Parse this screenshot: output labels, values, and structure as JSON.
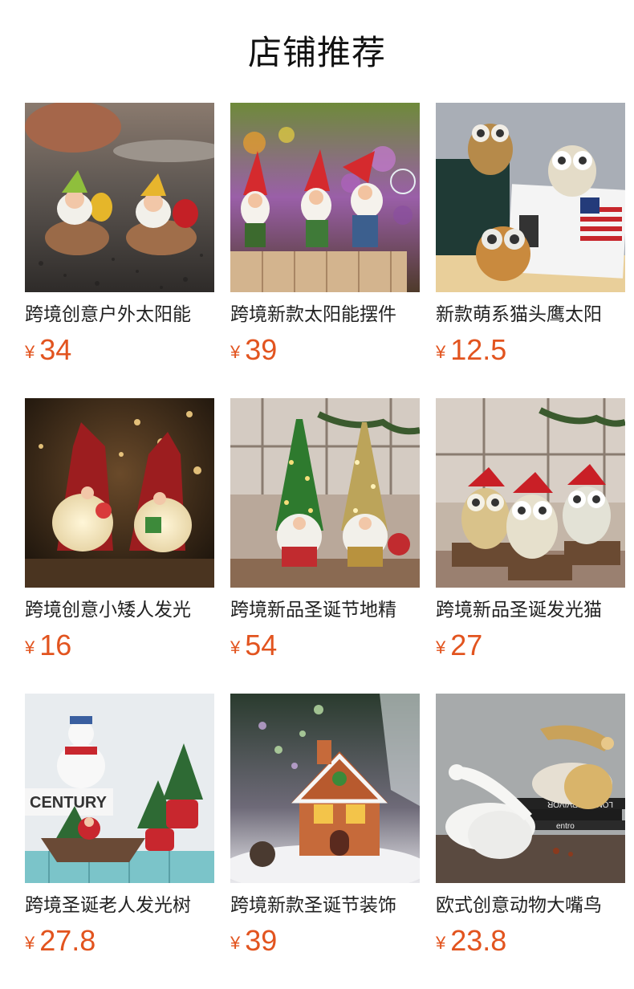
{
  "header": {
    "title": "店铺推荐"
  },
  "currency_symbol": "¥",
  "colors": {
    "price": "#e2541f",
    "text": "#222222",
    "title": "#111111"
  },
  "products": [
    {
      "name": "跨境创意户外太阳能",
      "price": "34",
      "image": "gnomes-on-rocks-image"
    },
    {
      "name": "跨境新款太阳能摆件",
      "price": "39",
      "image": "red-hat-gnomes-image"
    },
    {
      "name": "新款萌系猫头鹰太阳",
      "price": "12.5",
      "image": "owls-on-books-image"
    },
    {
      "name": "跨境创意小矮人发光",
      "price": "16",
      "image": "glowing-santa-gnomes-image"
    },
    {
      "name": "跨境新品圣诞节地精",
      "price": "54",
      "image": "tree-hat-gnomes-image"
    },
    {
      "name": "跨境新品圣诞发光猫",
      "price": "27",
      "image": "christmas-owls-image"
    },
    {
      "name": "跨境圣诞老人发光树",
      "price": "27.8",
      "image": "santa-boat-tree-image"
    },
    {
      "name": "跨境新款圣诞节装饰",
      "price": "39",
      "image": "gingerbread-house-image"
    },
    {
      "name": "欧式创意动物大嘴鸟",
      "price": "23.8",
      "image": "pelican-bowls-image"
    }
  ]
}
